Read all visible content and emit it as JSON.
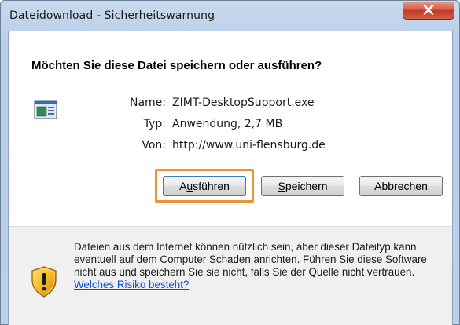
{
  "window": {
    "title": "Dateidownload - Sicherheitswarnung",
    "close_icon": "close-icon"
  },
  "dialog": {
    "question": "Möchten Sie diese Datei speichern oder ausführen?",
    "file": {
      "name_label": "Name:",
      "name_value": "ZIMT-DesktopSupport.exe",
      "type_label": "Typ:",
      "type_value": "Anwendung, 2,7 MB",
      "from_label": "Von:",
      "from_value": "http://www.uni-flensburg.de"
    },
    "buttons": {
      "run_pre": "A",
      "run_accel": "u",
      "run_post": "sführen",
      "save_accel": "S",
      "save_post": "peichern",
      "cancel": "Abbrechen"
    },
    "warning": {
      "text": "Dateien aus dem Internet können nützlich sein, aber dieser Dateityp kann eventuell auf dem Computer Schaden anrichten. Führen Sie diese Software nicht aus und speichern Sie sie nicht, falls Sie der Quelle nicht vertrauen.",
      "link": "Welches Risiko besteht?"
    }
  },
  "colors": {
    "focus_highlight": "#f0913a",
    "link": "#0a4fd6",
    "close_button": "#c23a22"
  }
}
